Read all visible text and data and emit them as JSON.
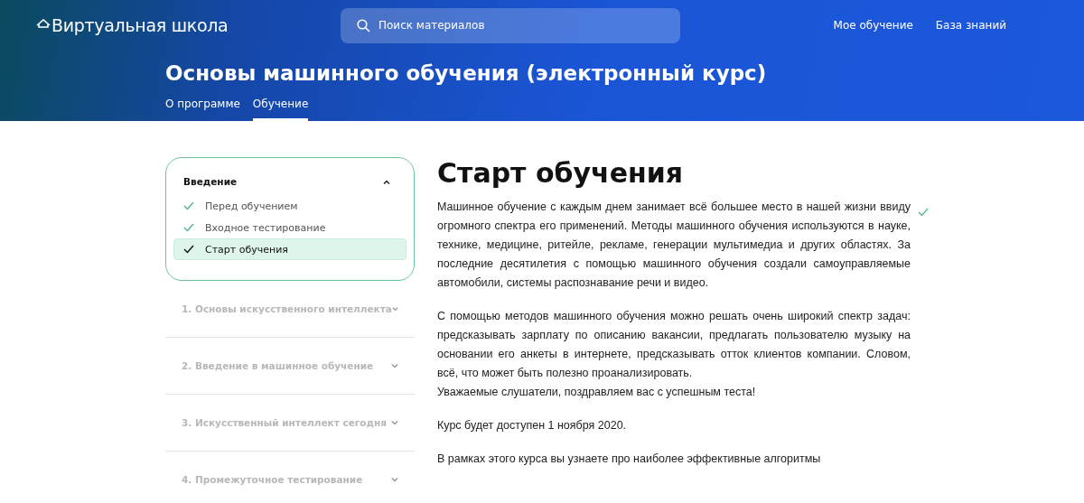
{
  "header": {
    "logo": "Виртуальная школа",
    "search": {
      "placeholder": "Поиск материалов"
    },
    "nav": [
      "Мое обучение",
      "База знаний"
    ],
    "title": "Основы машинного обучения (электронный курс)",
    "tabs": [
      {
        "label": "О программе",
        "selected": false
      },
      {
        "label": "Обучение",
        "selected": true
      }
    ]
  },
  "sidebar": {
    "sections": [
      {
        "title": "Введение",
        "expanded": true,
        "locked": false,
        "items": [
          {
            "label": "Перед обучением",
            "done": true,
            "selected": false
          },
          {
            "label": "Входное тестирование",
            "done": true,
            "selected": false
          },
          {
            "label": "Старт обучения",
            "done": true,
            "selected": true
          }
        ]
      },
      {
        "title": "1. Основы искусственного интеллекта",
        "expanded": false,
        "locked": true
      },
      {
        "title": "2. Введение в машинное обучение",
        "expanded": false,
        "locked": true
      },
      {
        "title": "3. Искусственный интеллект сегодня",
        "expanded": false,
        "locked": true
      },
      {
        "title": "4. Промежуточное тестирование",
        "expanded": false,
        "locked": true
      }
    ]
  },
  "content": {
    "title": "Старт обучения",
    "completed": true,
    "paragraphs": [
      {
        "lines": [
          "Машинное обучение с каждым днем занимает всё большее место в нашей жизни ввиду огромного спектра его применений. Методы машинного обучения используются в науке, технике, медицине, ритейле, рекламе, генерации мультимедиа и других областях. За последние десятилетия с помощью машинного обучения создали самоуправляемые автомобили, системы распознавание речи и видео."
        ]
      },
      {
        "lines": [
          "С помощью методов машинного обучения можно решать очень широкий спектр задач: предсказывать зарплату по описанию вакансии, предлагать пользователю музыку на основании его анкеты в интернете, предсказывать отток клиентов компании. Словом, всё, что может быть полезно проанализировать.",
          "Уважаемые слушатели, поздравляем вас с успешным теста!"
        ]
      },
      {
        "lines": [
          "Курс будет доступен 1 ноября 2020."
        ]
      },
      {
        "lines": [
          "В рамках этого курса вы узнаете про наиболее эффективные алгоритмы"
        ]
      }
    ]
  }
}
